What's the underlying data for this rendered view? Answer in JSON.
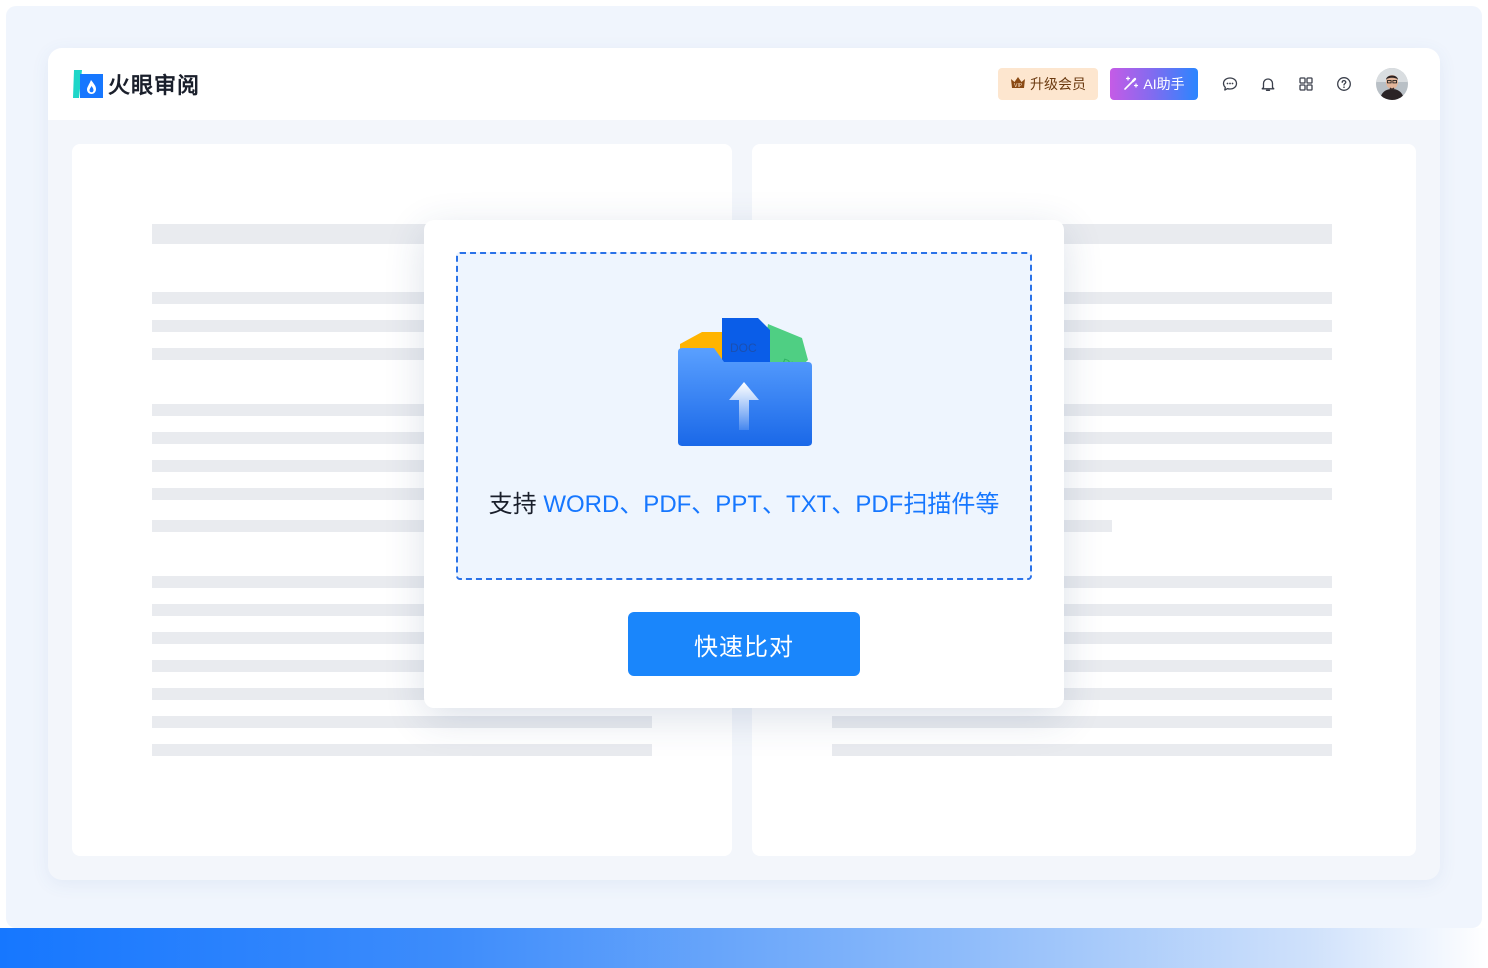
{
  "app": {
    "title": "火眼审阅"
  },
  "header": {
    "vip_label": "升级会员",
    "ai_label": "AI助手",
    "icons": [
      "message-icon",
      "bell-icon",
      "apps-grid-icon",
      "help-icon"
    ]
  },
  "upload": {
    "folder_tags": [
      "DOC",
      "PDF"
    ],
    "support_prefix": "支持 ",
    "support_formats": "WORD、PDF、PPT、TXT、PDF扫描件等",
    "compare_label": "快速比对"
  },
  "colors": {
    "accent": "#1677ff",
    "vip_bg": "#fde6cf",
    "dropzone_bg": "#eef5fe",
    "placeholder_line": "#e9ebef"
  }
}
